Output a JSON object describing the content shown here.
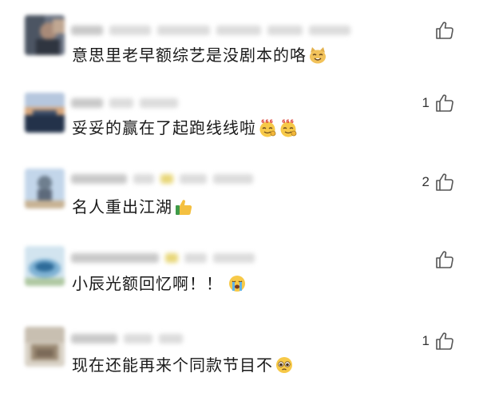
{
  "comments": [
    {
      "text": "意思里老早额综艺是没剧本的咯",
      "likes": "",
      "emoji": [
        "cat-laugh-emoji"
      ],
      "avatar_colors": [
        "#5b6574",
        "#8a6a5a",
        "#2f3540",
        "#b29a88"
      ]
    },
    {
      "text": "妥妥的赢在了起跑线线啦",
      "likes": "1",
      "emoji": [
        "666-emoji",
        "666-emoji"
      ],
      "avatar_colors": [
        "#8fa5c4",
        "#3b4e69",
        "#d7a77d",
        "#23324a"
      ]
    },
    {
      "text": "名人重出江湖",
      "likes": "2",
      "emoji": [
        "thumbs-up-emoji"
      ],
      "avatar_colors": [
        "#a9c2dc",
        "#6f7f8f",
        "#c8b394",
        "#5d6a7b"
      ]
    },
    {
      "text": "小辰光额回忆啊！！",
      "likes": "",
      "emoji": [
        "crying-emoji"
      ],
      "avatar_colors": [
        "#7fb2d4",
        "#2e6c9a",
        "#d2e4ef",
        "#b0c9a3"
      ]
    },
    {
      "text": "现在还能再来个同款节目不",
      "likes": "1",
      "emoji": [
        "pleading-emoji"
      ],
      "avatar_colors": [
        "#c8bfb1",
        "#9b8a74",
        "#7b6a58",
        "#d9d2c6"
      ]
    }
  ]
}
